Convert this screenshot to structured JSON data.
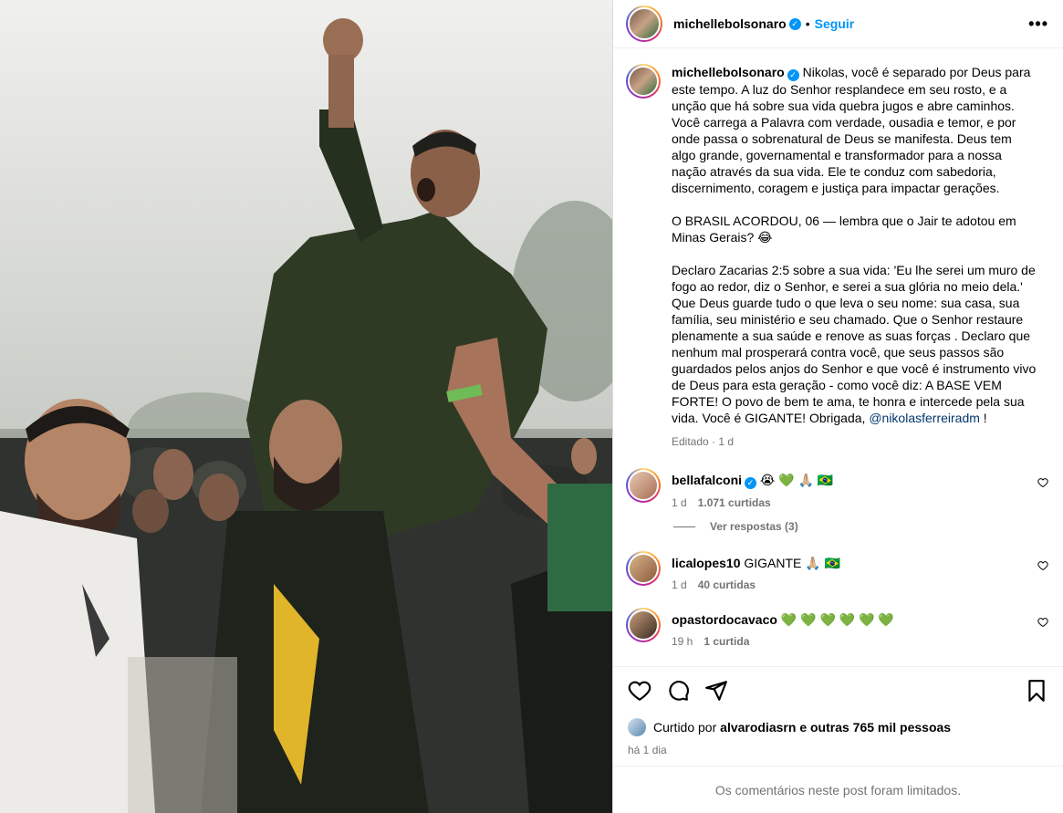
{
  "post": {
    "author": "michellebolsonaro",
    "follow_label": "Seguir",
    "dot": "•",
    "more_label": "•••"
  },
  "caption": {
    "author": "michellebolsonaro",
    "p1": "Nikolas, você é separado por Deus para este tempo. A luz do Senhor resplandece em seu rosto, e a unção que há sobre sua vida quebra jugos e abre caminhos. Você carrega a Palavra com verdade, ousadia e temor, e por onde passa o sobrenatural de Deus se manifesta. Deus tem algo grande, governamental e transformador para a nossa nação através da sua vida. Ele te conduz com sabedoria, discernimento, coragem e justiça para impactar gerações.",
    "p2": "O BRASIL ACORDOU, 06 — lembra que o Jair te adotou em Minas Gerais? 😂",
    "p3": "Declaro Zacarias 2:5 sobre a sua vida: 'Eu lhe serei um muro de fogo ao redor, diz o Senhor, e serei a sua glória no meio dela.' Que Deus guarde tudo o que leva o seu nome: sua casa, sua família, seu ministério e seu chamado. Que o Senhor restaure plenamente a sua saúde e renove as suas forças . Declaro que nenhum mal prosperará contra você, que seus passos são guardados pelos anjos do Senhor e que você é instrumento vivo de Deus para esta geração - como você diz: A BASE VEM FORTE! O povo de bem te ama, te honra e intercede pela sua vida. Você é GIGANTE! Obrigada,",
    "mention": "@nikolasferreiradm",
    "end": " !",
    "edited": "Editado",
    "age": "1 d"
  },
  "comments": [
    {
      "user": "bellafalconi",
      "text": "😭 💚 🙏🏼 🇧🇷",
      "age": "1 d",
      "likes": "1.071 curtidas",
      "verified": true
    },
    {
      "user": "licalopes10",
      "text": "GIGANTE 🙏🏼 🇧🇷",
      "age": "1 d",
      "likes": "40 curtidas",
      "verified": false
    },
    {
      "user": "opastordocavaco",
      "text": "💚 💚 💚 💚 💚 💚",
      "age": "19 h",
      "likes": "1 curtida",
      "verified": false
    }
  ],
  "replies_label": "Ver respostas (3)",
  "likes": {
    "prefix": "Curtido por",
    "user": "alvarodiasrn",
    "suffix": "e outras 765 mil pessoas"
  },
  "time": "há 1 dia",
  "limited_notice": "Os comentários neste post foram limitados.",
  "icons": [
    "heart-icon",
    "comment-icon",
    "share-icon",
    "bookmark-icon",
    "verified-icon",
    "more-icon"
  ],
  "colors": {
    "accent": "#0095f6",
    "secondary_text": "#737373",
    "mention": "#00376b"
  }
}
